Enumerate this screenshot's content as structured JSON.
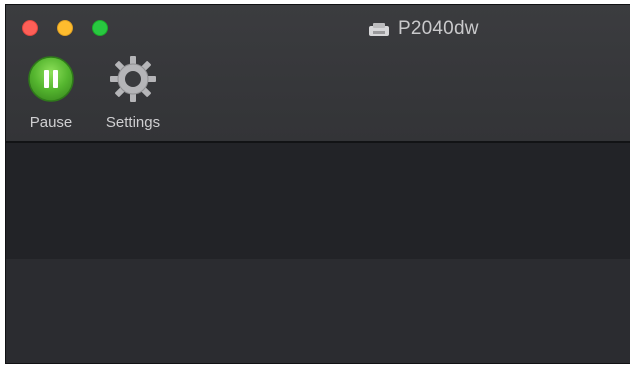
{
  "window": {
    "title": "P2040dw",
    "title_icon": "printer-icon"
  },
  "traffic_lights": {
    "close_color": "#fe5f57",
    "minimize_color": "#febc2e",
    "maximize_color": "#28c840"
  },
  "toolbar": {
    "pause_label": "Pause",
    "pause_icon": "pause-icon",
    "pause_color": "#5dbf3a",
    "settings_label": "Settings",
    "settings_icon": "gear-icon"
  },
  "job_list": {
    "rows": []
  }
}
